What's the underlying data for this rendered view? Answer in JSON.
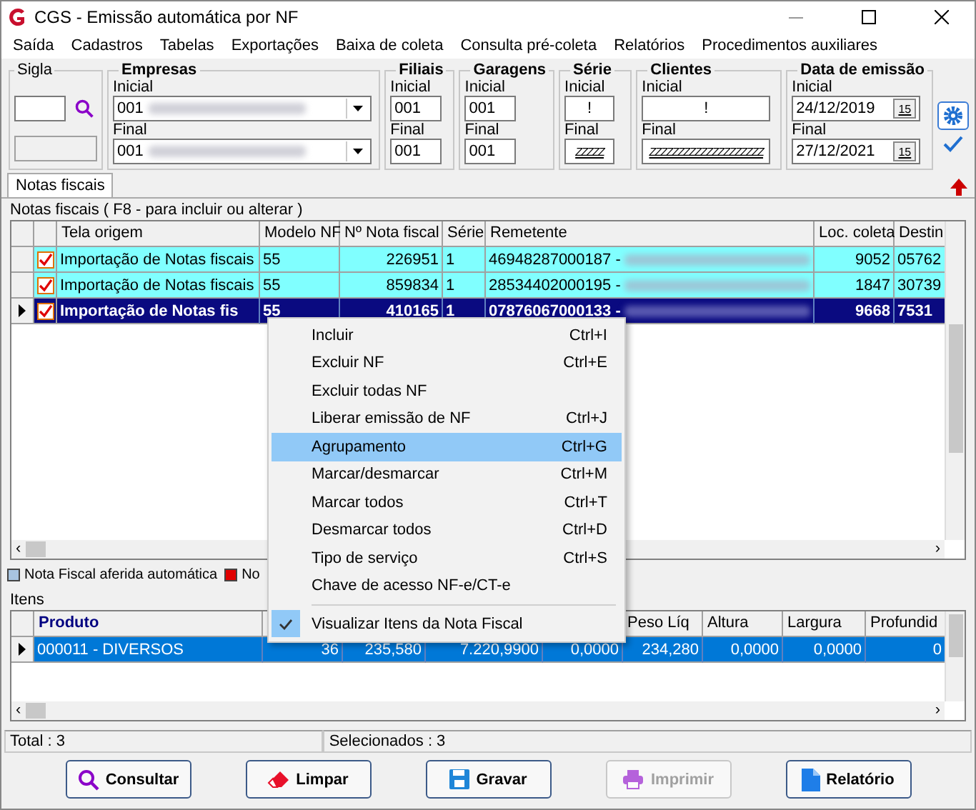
{
  "window": {
    "title": "CGS - Emissão automática por NF"
  },
  "menu": [
    "Saída",
    "Cadastros",
    "Tabelas",
    "Exportações",
    "Baixa de coleta",
    "Consulta pré-coleta",
    "Relatórios",
    "Procedimentos auxiliares"
  ],
  "filters": {
    "sigla": {
      "label": "Sigla"
    },
    "empresas": {
      "label": "Empresas",
      "inicial_label": "Inicial",
      "inicial": "001",
      "final_label": "Final",
      "final": "001"
    },
    "filiais": {
      "label": "Filiais",
      "inicial_label": "Inicial",
      "inicial": "001",
      "final_label": "Final",
      "final": "001"
    },
    "garagens": {
      "label": "Garagens",
      "inicial_label": "Inicial",
      "inicial": "001",
      "final_label": "Final",
      "final": "001"
    },
    "serie": {
      "label": "Série",
      "inicial_label": "Inicial",
      "inicial": "!",
      "final_label": "Final",
      "final": "ZZZZZ"
    },
    "clientes": {
      "label": "Clientes",
      "inicial_label": "Inicial",
      "inicial": "!",
      "final_label": "Final",
      "final": "ZZZZZZZZZZZZZZZZZZZZ"
    },
    "data": {
      "label": "Data de emissão",
      "inicial_label": "Inicial",
      "inicial": "24/12/2019",
      "final_label": "Final",
      "final": "27/12/2021",
      "calendar_glyphs": [
        "15",
        "15"
      ]
    }
  },
  "tabs": [
    {
      "label": "Notas fiscais",
      "selected": true
    }
  ],
  "grid": {
    "caption": "Notas fiscais ( F8 - para incluir ou alterar )",
    "columns": [
      "Tela origem",
      "Modelo NF",
      "Nº Nota fiscal",
      "Série",
      "Remetente",
      "Loc. coleta",
      "Destin"
    ],
    "rows": [
      {
        "selected": false,
        "checked": true,
        "cells": [
          "Importação de Notas fiscais",
          "55",
          "226951",
          "1",
          "46948287000187 -",
          "9052",
          "05762"
        ]
      },
      {
        "selected": false,
        "checked": true,
        "cells": [
          "Importação de Notas fiscais",
          "55",
          "859834",
          "1",
          "28534402000195 -",
          "1847",
          "30739"
        ]
      },
      {
        "selected": true,
        "checked": true,
        "cells": [
          "Importação de Notas fis",
          "55",
          "410165",
          "1",
          "07876067000133 -",
          "9668",
          "7531"
        ]
      }
    ]
  },
  "legend": [
    {
      "label": "Nota Fiscal aferida automática",
      "color": "#a8c4e0"
    },
    {
      "label": "No",
      "color": "#e00000"
    }
  ],
  "items": {
    "caption": "Itens",
    "columns": [
      "Produto",
      null,
      null,
      null,
      null,
      "Peso Líq",
      "Altura",
      "Largura",
      "Profundid"
    ],
    "rows": [
      {
        "selected": true,
        "cells": [
          "000011 - DIVERSOS",
          "36",
          "235,580",
          "7.220,9900",
          "0,0000",
          "234,280",
          "0,0000",
          "0,0000",
          "0"
        ]
      }
    ]
  },
  "context_menu": [
    {
      "label": "Incluir",
      "shortcut": "Ctrl+I",
      "selected": false,
      "checked": false,
      "separator_before": false
    },
    {
      "label": "Excluir NF",
      "shortcut": "Ctrl+E",
      "selected": false,
      "checked": false,
      "separator_before": false
    },
    {
      "label": "Excluir todas NF",
      "selected": false,
      "checked": false,
      "separator_before": false
    },
    {
      "label": "Liberar emissão de NF",
      "shortcut": "Ctrl+J",
      "selected": false,
      "checked": false,
      "separator_before": false
    },
    {
      "label": "Agrupamento",
      "shortcut": "Ctrl+G",
      "selected": true,
      "checked": false,
      "separator_before": false
    },
    {
      "label": "Marcar/desmarcar",
      "shortcut": "Ctrl+M",
      "selected": false,
      "checked": false,
      "separator_before": false
    },
    {
      "label": "Marcar todos",
      "shortcut": "Ctrl+T",
      "selected": false,
      "checked": false,
      "separator_before": false
    },
    {
      "label": "Desmarcar todos",
      "shortcut": "Ctrl+D",
      "selected": false,
      "checked": false,
      "separator_before": false
    },
    {
      "label": "Tipo de serviço",
      "shortcut": "Ctrl+S",
      "selected": false,
      "checked": false,
      "separator_before": false
    },
    {
      "label": "Chave de acesso NF-e/CT-e",
      "selected": false,
      "checked": false,
      "separator_before": false
    },
    {
      "label": "Visualizar Itens da Nota Fiscal",
      "selected": false,
      "checked": true,
      "separator_before": true
    }
  ],
  "scroll_arrows": [
    "‹",
    "›",
    "‹",
    "›"
  ],
  "status_bar": [
    "Total : 3",
    "Selecionados : 3"
  ],
  "buttons": [
    {
      "label": "Consultar",
      "kind": "search",
      "disabled": false
    },
    {
      "label": "Limpar",
      "kind": "eraser",
      "disabled": false
    },
    {
      "label": "Gravar",
      "kind": "save",
      "disabled": false
    },
    {
      "label": "Imprimir",
      "kind": "print",
      "disabled": true
    },
    {
      "label": "Relatório",
      "kind": "report",
      "disabled": false
    }
  ]
}
